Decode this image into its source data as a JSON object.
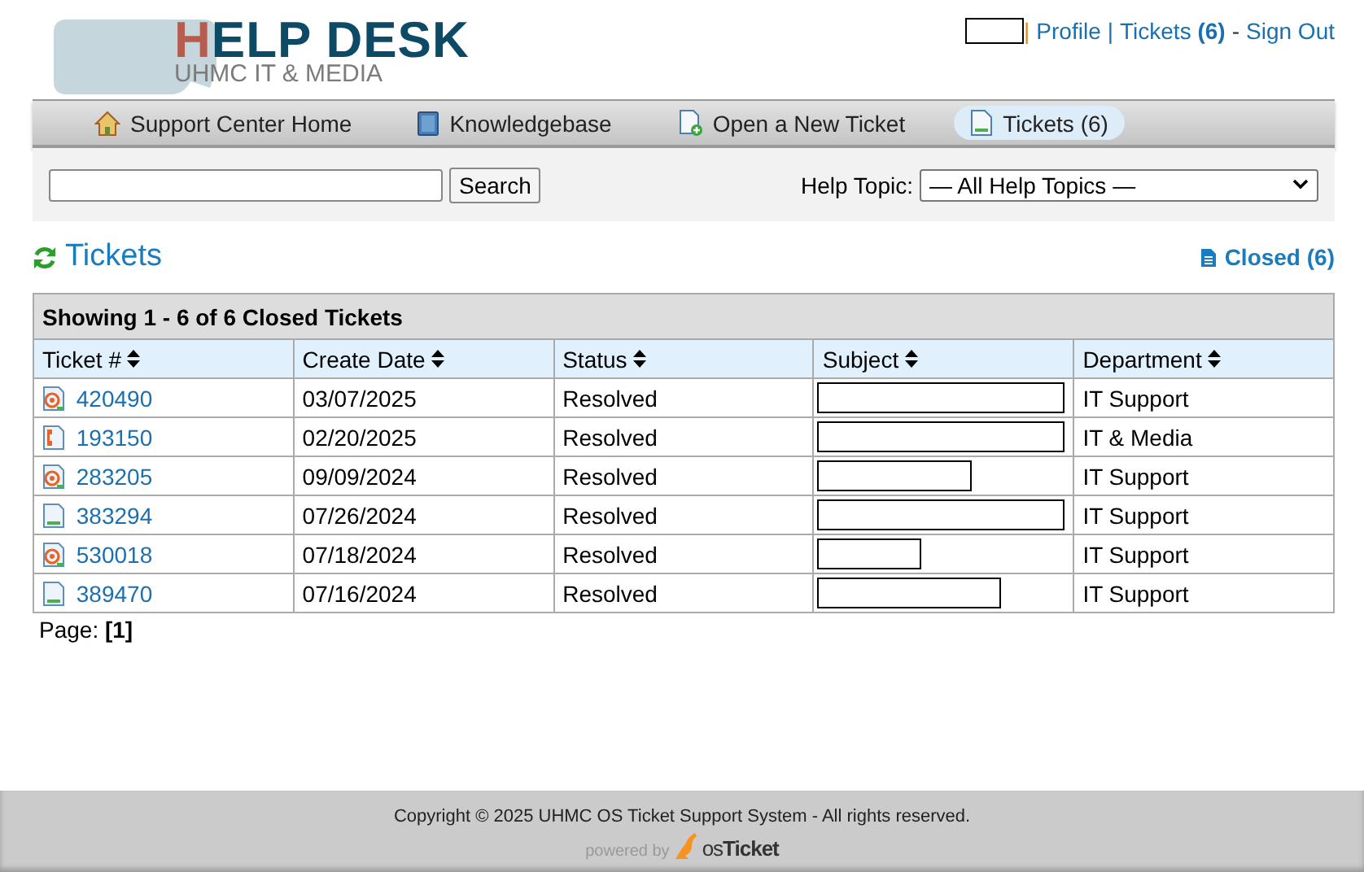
{
  "logo": {
    "title_first": "H",
    "title_rest": "ELP DESK",
    "subtitle": "UHMC IT & MEDIA"
  },
  "user_nav": {
    "separator": "|",
    "profile": "Profile",
    "tickets_label": "Tickets",
    "tickets_count": "(6)",
    "dash": "-",
    "sign_out": "Sign Out"
  },
  "nav_tabs": [
    {
      "label": "Support Center Home",
      "kind": "home",
      "selected": false
    },
    {
      "label": "Knowledgebase",
      "kind": "book",
      "selected": false
    },
    {
      "label": "Open a New Ticket",
      "kind": "new",
      "selected": false
    },
    {
      "label": "Tickets (6)",
      "kind": "doc",
      "selected": true
    }
  ],
  "search": {
    "button": "Search",
    "topic_label": "Help Topic:",
    "topic_value": "— All Help Topics —"
  },
  "heading": "Tickets",
  "closed_link": "Closed (6)",
  "table": {
    "caption": "Showing 1 - 6 of 6 Closed Tickets",
    "columns": [
      "Ticket #",
      "Create Date",
      "Status",
      "Subject",
      "Department"
    ],
    "rows": [
      {
        "kind": "email",
        "ticket": "420490",
        "date": "03/07/2025",
        "status": "Resolved",
        "level": 1,
        "department": "IT Support"
      },
      {
        "kind": "phone",
        "ticket": "193150",
        "date": "02/20/2025",
        "status": "Resolved",
        "level": 1,
        "department": "IT & Media"
      },
      {
        "kind": "email",
        "ticket": "283205",
        "date": "09/09/2024",
        "status": "Resolved",
        "level": 0.62,
        "department": "IT Support"
      },
      {
        "kind": "web",
        "ticket": "383294",
        "date": "07/26/2024",
        "status": "Resolved",
        "level": 1,
        "department": "IT Support"
      },
      {
        "kind": "email",
        "ticket": "530018",
        "date": "07/18/2024",
        "status": "Resolved",
        "level": 0.42,
        "department": "IT Support"
      },
      {
        "kind": "web",
        "ticket": "389470",
        "date": "07/16/2024",
        "status": "Resolved",
        "level": 0.74,
        "department": "IT Support"
      }
    ]
  },
  "pagination": {
    "label": "Page:",
    "current": "[1]"
  },
  "footer": {
    "copyright": "Copyright © 2025 UHMC OS Ticket Support System - All rights reserved.",
    "powered": "powered by",
    "brand_os": "os",
    "brand_name": "Ticket"
  }
}
